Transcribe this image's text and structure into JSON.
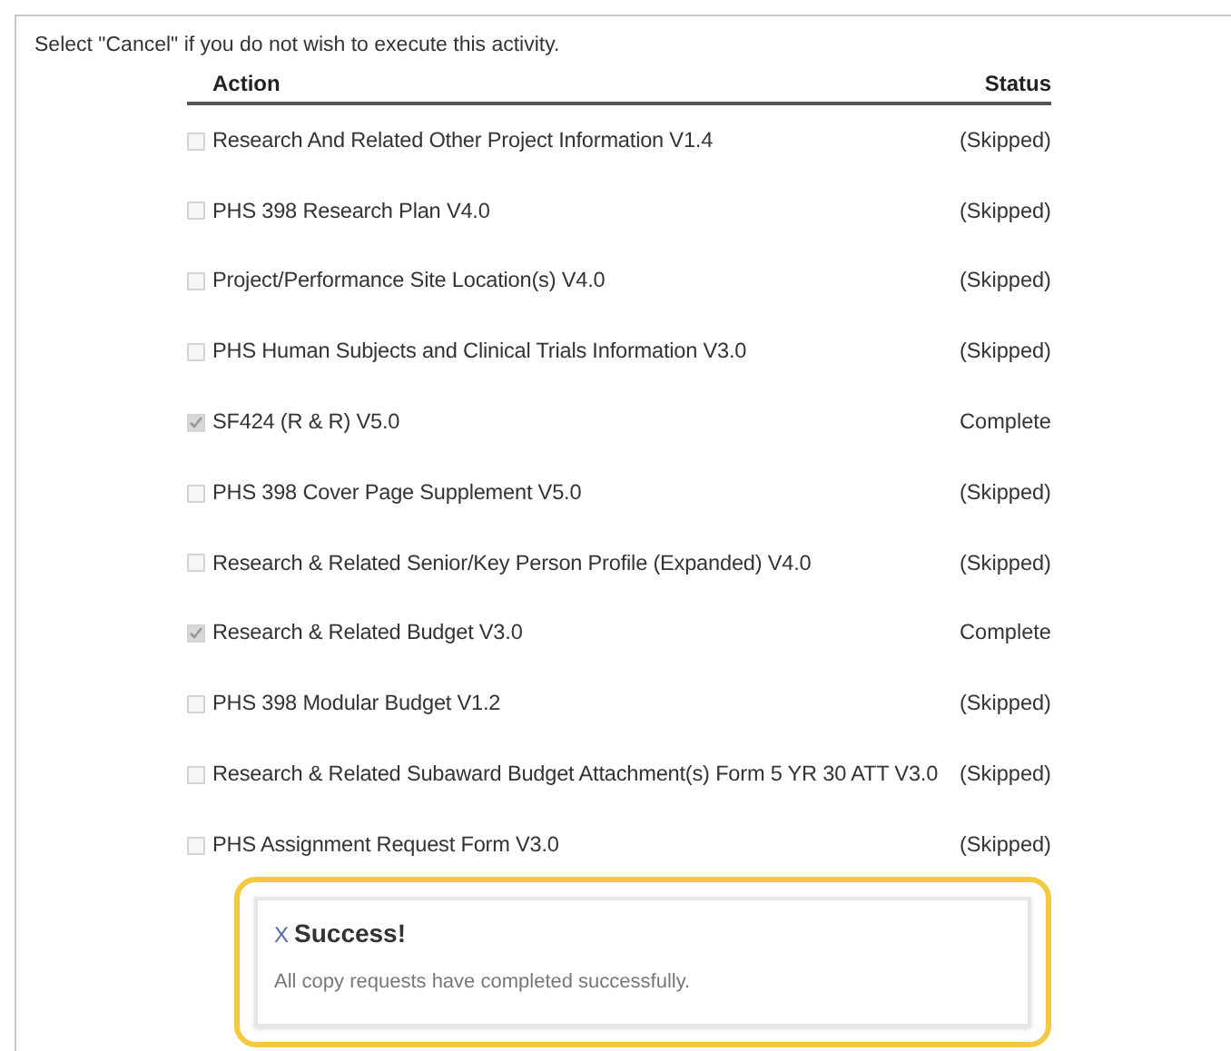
{
  "instruction": "Select \"Cancel\" if you do not wish to execute this activity.",
  "table": {
    "columns": [
      "Action",
      "Status"
    ],
    "rows": [
      {
        "action": "Research And Related Other Project Information V1.4",
        "status": "(Skipped)",
        "checked": false
      },
      {
        "action": "PHS 398 Research Plan V4.0",
        "status": "(Skipped)",
        "checked": false
      },
      {
        "action": "Project/Performance Site Location(s) V4.0",
        "status": "(Skipped)",
        "checked": false
      },
      {
        "action": "PHS Human Subjects and Clinical Trials Information V3.0",
        "status": "(Skipped)",
        "checked": false
      },
      {
        "action": "SF424 (R & R) V5.0",
        "status": "Complete",
        "checked": true
      },
      {
        "action": "PHS 398 Cover Page Supplement V5.0",
        "status": "(Skipped)",
        "checked": false
      },
      {
        "action": "Research & Related Senior/Key Person Profile (Expanded) V4.0",
        "status": "(Skipped)",
        "checked": false
      },
      {
        "action": "Research & Related Budget V3.0",
        "status": "Complete",
        "checked": true
      },
      {
        "action": "PHS 398 Modular Budget V1.2",
        "status": "(Skipped)",
        "checked": false
      },
      {
        "action": "Research & Related Subaward Budget Attachment(s) Form 5 YR 30 ATT V3.0",
        "status": "(Skipped)",
        "checked": false
      },
      {
        "action": "PHS Assignment Request Form V3.0",
        "status": "(Skipped)",
        "checked": false
      }
    ]
  },
  "alert": {
    "close": "X",
    "title": "Success!",
    "message": "All copy requests have completed successfully."
  }
}
